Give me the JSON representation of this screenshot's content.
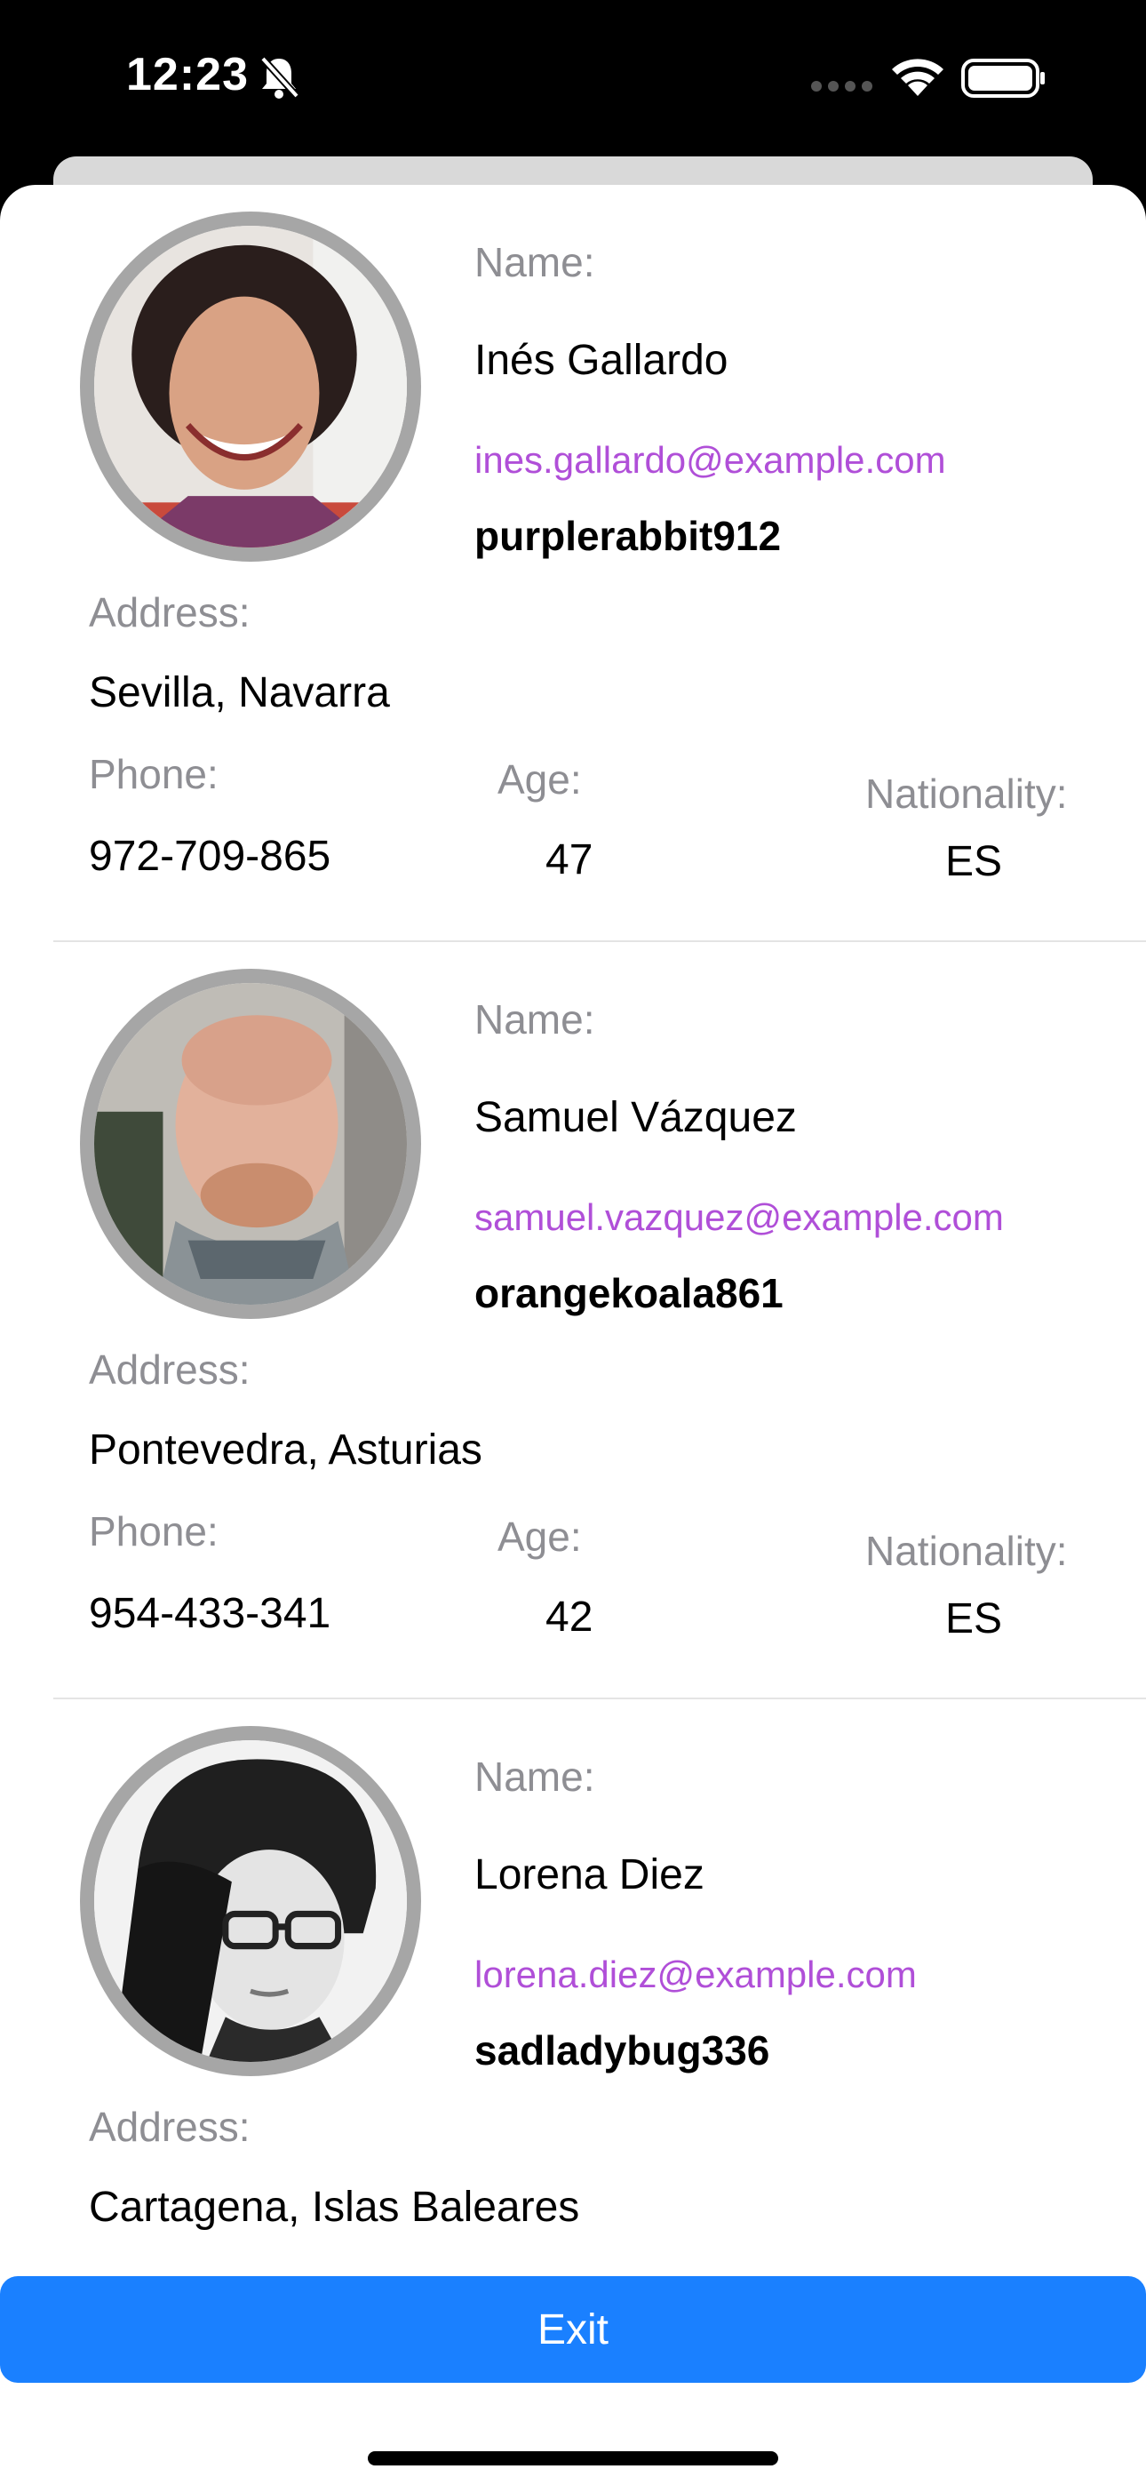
{
  "status_bar": {
    "time": "12:23",
    "icons": [
      "bell-slash-icon",
      "signal-icon",
      "wifi-icon",
      "battery-icon"
    ]
  },
  "labels": {
    "name": "Name:",
    "address": "Address:",
    "phone": "Phone:",
    "age": "Age:",
    "nationality": "Nationality:"
  },
  "users": [
    {
      "name": "Inés Gallardo",
      "email": "ines.gallardo@example.com",
      "username": "purplerabbit912",
      "address": "Sevilla, Navarra",
      "phone": "972-709-865",
      "age": "47",
      "nationality": "ES"
    },
    {
      "name": "Samuel Vázquez",
      "email": "samuel.vazquez@example.com",
      "username": "orangekoala861",
      "address": "Pontevedra, Asturias",
      "phone": "954-433-341",
      "age": "42",
      "nationality": "ES"
    },
    {
      "name": "Lorena Diez",
      "email": "lorena.diez@example.com",
      "username": "sadladybug336",
      "address": "Cartagena, Islas Baleares"
    }
  ],
  "exit_label": "Exit",
  "colors": {
    "email": "#b04fd8",
    "button": "#1a80ff",
    "label": "#8e8e93",
    "avatar_border": "#a6a6a6"
  }
}
